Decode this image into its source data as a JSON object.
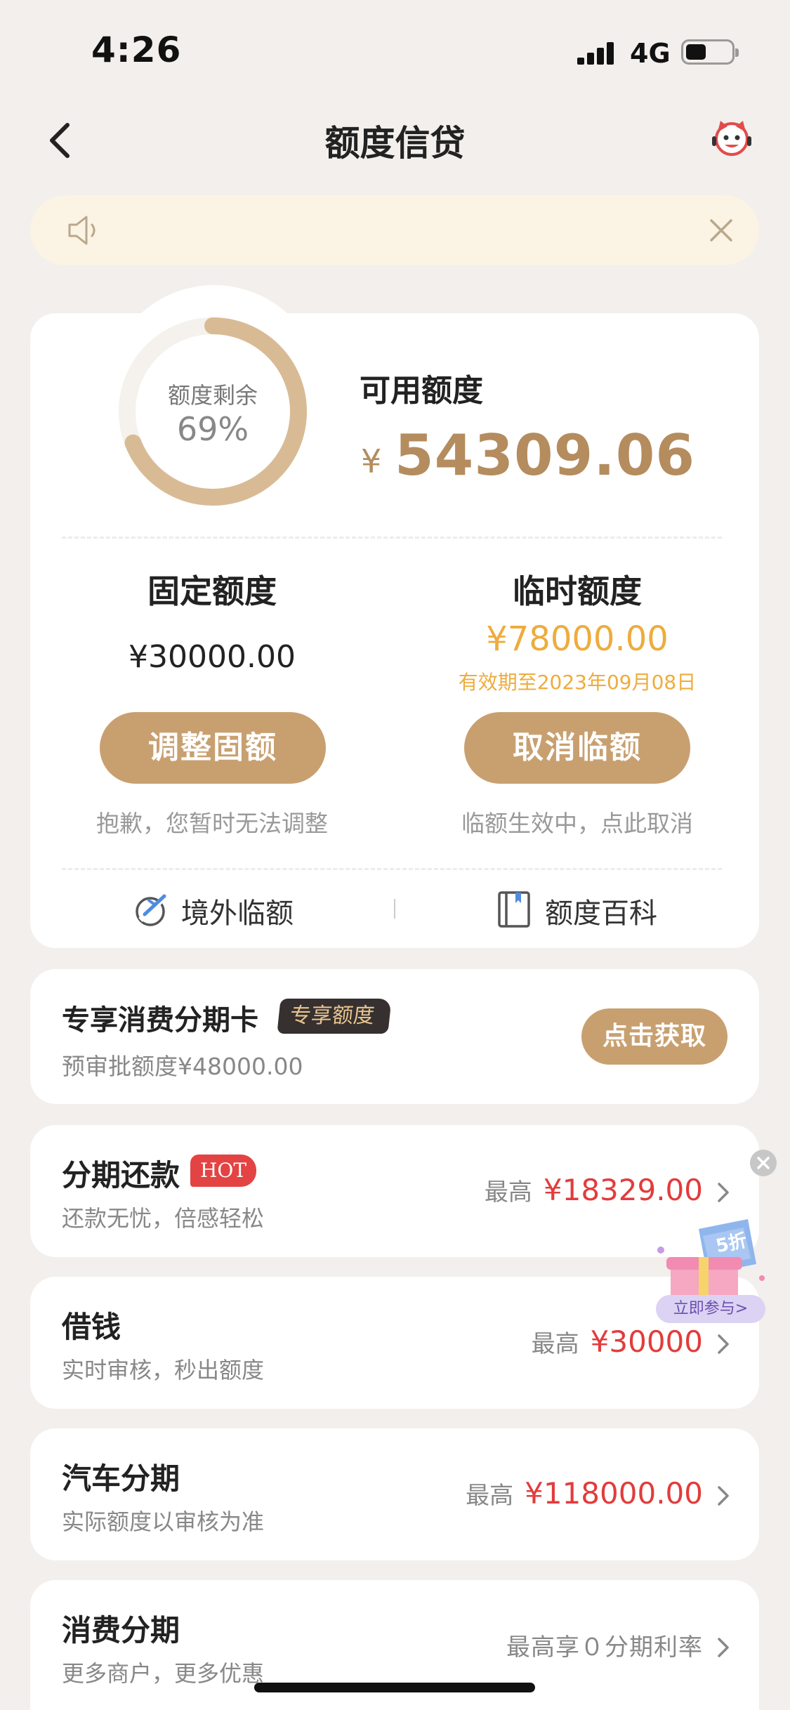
{
  "status_bar": {
    "time": "4:26",
    "network": "4G"
  },
  "nav": {
    "title": "额度信贷"
  },
  "summary": {
    "ring_label": "额度剩余",
    "ring_percent": "69%",
    "ring_fraction": 0.69,
    "available_label": "可用额度",
    "available_currency": "¥",
    "available_amount": "54309.06"
  },
  "fixed": {
    "title": "固定额度",
    "amount": "¥30000.00",
    "button": "调整固额",
    "note": "抱歉，您暂时无法调整"
  },
  "temp": {
    "title": "临时额度",
    "amount": "¥78000.00",
    "validity": "有效期至2023年09月08日",
    "button": "取消临额",
    "note": "临额生效中，点此取消"
  },
  "links": {
    "overseas": "境外临额",
    "wiki": "额度百科"
  },
  "promo": {
    "title": "专享消费分期卡",
    "tag": "专享额度",
    "subtitle": "预审批额度¥48000.00",
    "button": "点击获取"
  },
  "rows": [
    {
      "title": "分期还款",
      "badge": "HOT",
      "subtitle": "还款无忧，倍感轻松",
      "label": "最高",
      "amount": "¥18329.00"
    },
    {
      "title": "借钱",
      "subtitle": "实时审核，秒出额度",
      "label": "最高",
      "amount": "¥30000"
    },
    {
      "title": "汽车分期",
      "subtitle": "实际额度以审核为准",
      "label": "最高",
      "amount": "¥118000.00"
    },
    {
      "title": "消费分期",
      "subtitle": "更多商户，更多优惠",
      "label": "最高享０分期利率"
    }
  ],
  "floating": {
    "discount": "5折",
    "join": "立即参与>"
  },
  "colors": {
    "gold": "#c8a070",
    "accent_text": "#b48c5e",
    "orange": "#eeac3d",
    "red": "#e23c3c"
  }
}
